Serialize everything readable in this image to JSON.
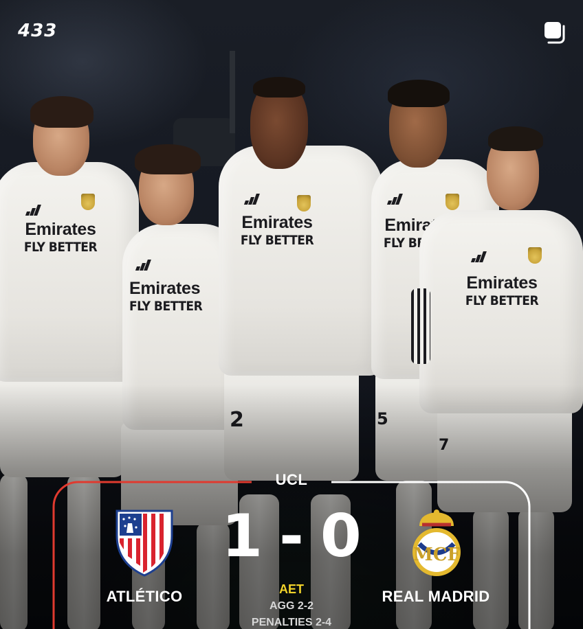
{
  "brand": {
    "name": "433"
  },
  "players": {
    "p1": {
      "sponsor_top": "Emirates",
      "sponsor_bottom": "FLY BETTER"
    },
    "p2": {
      "sponsor_top": "Emirates",
      "sponsor_bottom": "FLY BETTER"
    },
    "p3": {
      "sponsor_top": "Emirates",
      "sponsor_bottom": "FLY BETTER",
      "number": "2"
    },
    "p4": {
      "sponsor_top": "Emirates",
      "sponsor_bottom": "FLY BETTER",
      "number": "5"
    },
    "p5": {
      "sponsor_top": "Emirates",
      "sponsor_bottom": "FLY BETTER",
      "number": "7"
    }
  },
  "match": {
    "competition": "UCL",
    "home_goals": "1",
    "separator": "-",
    "away_goals": "0",
    "home_team": "ATLÉTICO",
    "away_team": "REAL MADRID",
    "status": "AET",
    "aggregate": "AGG 2-2",
    "penalties": "PENALTIES 2-4"
  },
  "colors": {
    "accent_red": "#e03a2f",
    "status_yellow": "#f2d32a",
    "outline_white": "#ffffff"
  },
  "icons": {
    "copy": "copy-icon",
    "home_crest": "atletico-crest-icon",
    "away_crest": "real-madrid-crest-icon"
  }
}
